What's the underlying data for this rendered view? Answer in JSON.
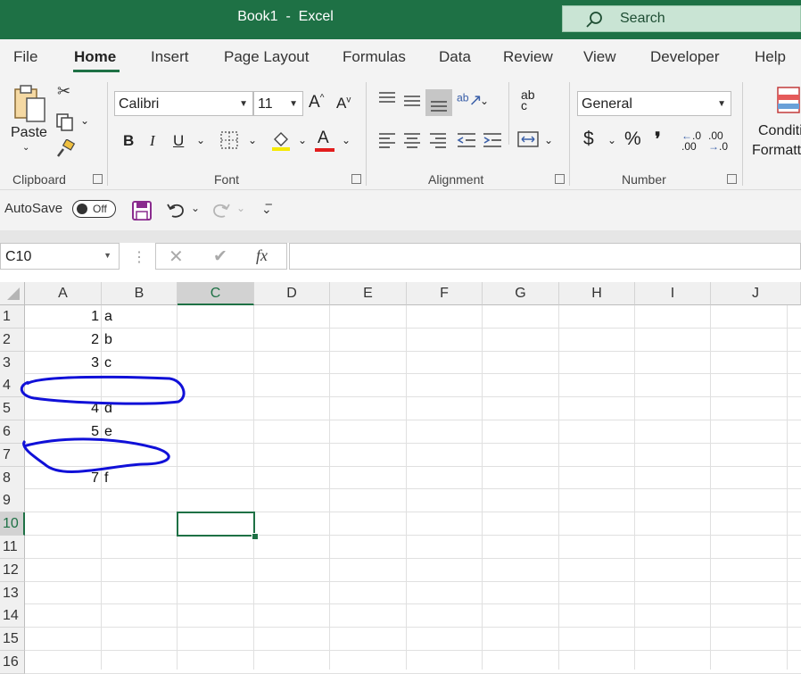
{
  "app": {
    "title": "Book1  -  Excel",
    "search_label": "Search"
  },
  "tabs": [
    "File",
    "Home",
    "Insert",
    "Page Layout",
    "Formulas",
    "Data",
    "Review",
    "View",
    "Developer",
    "Help"
  ],
  "ribbon": {
    "clipboard": {
      "paste_label": "Paste",
      "group_label": "Clipboard"
    },
    "font": {
      "font_name": "Calibri",
      "font_size": "11",
      "bold": "B",
      "italic": "I",
      "underline": "U",
      "group_label": "Font",
      "grow": "A",
      "shrink": "A",
      "font_color_letter": "A"
    },
    "alignment": {
      "group_label": "Alignment",
      "wrap_text": "ab c"
    },
    "number": {
      "format": "General",
      "currency": "$",
      "percent": "%",
      "comma": "❜",
      "increase_decimal": ".00",
      "decrease_decimal": ".00",
      "group_label": "Number"
    },
    "styles": {
      "conditional_line1": "Conditi",
      "conditional_line2": "Formatti"
    }
  },
  "qat": {
    "autosave_label": "AutoSave",
    "toggle_state": "Off"
  },
  "formula_bar": {
    "name_box": "C10",
    "fx": "fx",
    "formula": ""
  },
  "grid": {
    "columns": [
      "A",
      "B",
      "C",
      "D",
      "E",
      "F",
      "G",
      "H",
      "I",
      "J"
    ],
    "selected_column": "C",
    "rows": [
      "1",
      "2",
      "3",
      "4",
      "5",
      "6",
      "7",
      "8",
      "9",
      "10",
      "11",
      "12",
      "13",
      "14",
      "15",
      "16"
    ],
    "selected_row": "10",
    "cells": [
      {
        "row": 1,
        "a": "1",
        "b": "a"
      },
      {
        "row": 2,
        "a": "2",
        "b": "b"
      },
      {
        "row": 3,
        "a": "3",
        "b": "c"
      },
      {
        "row": 5,
        "a": "4",
        "b": "d"
      },
      {
        "row": 6,
        "a": "5",
        "b": "e"
      },
      {
        "row": 8,
        "a": "7",
        "b": "f"
      }
    ]
  },
  "annotation": {
    "color": "#1010d8"
  },
  "colors": {
    "brand": "#1e7145",
    "font_color": "#e21d1d",
    "highlight": "#f5e900"
  }
}
